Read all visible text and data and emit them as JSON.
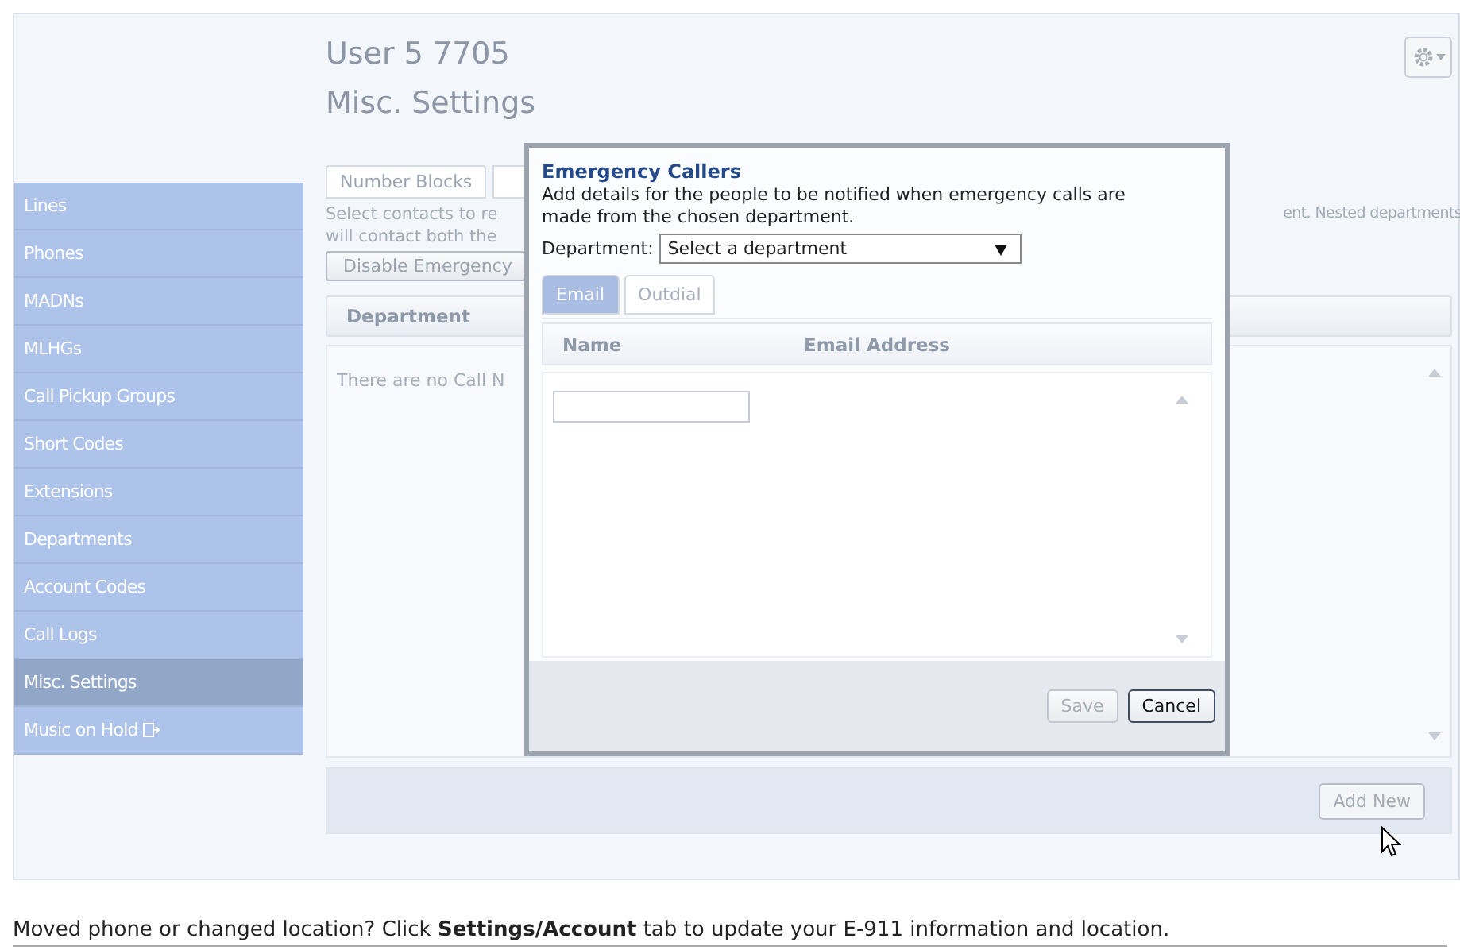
{
  "header": {
    "title": "User 5 7705",
    "subtitle": "Misc. Settings"
  },
  "sidebar": {
    "items": [
      {
        "label": "Lines",
        "selected": false,
        "kind": "plain"
      },
      {
        "label": "Phones",
        "selected": false,
        "kind": "plain"
      },
      {
        "label": "MADNs",
        "selected": false,
        "kind": "plain"
      },
      {
        "label": "MLHGs",
        "selected": false,
        "kind": "plain"
      },
      {
        "label": "Call Pickup Groups",
        "selected": false,
        "kind": "plain"
      },
      {
        "label": "Short Codes",
        "selected": false,
        "kind": "plain"
      },
      {
        "label": "Extensions",
        "selected": false,
        "kind": "plain"
      },
      {
        "label": "Departments",
        "selected": false,
        "kind": "plain"
      },
      {
        "label": "Account Codes",
        "selected": false,
        "kind": "plain"
      },
      {
        "label": "Call Logs",
        "selected": false,
        "kind": "plain"
      },
      {
        "label": "Misc. Settings",
        "selected": true,
        "kind": "plain"
      },
      {
        "label": "Music on Hold",
        "selected": false,
        "kind": "external"
      }
    ]
  },
  "tabs": [
    {
      "label": "Number Blocks",
      "selected": false
    }
  ],
  "description": {
    "line_1": "Select contacts to re",
    "line_2": "will contact both the",
    "right_part": "ent. Nested departments"
  },
  "disable_button": "Disable Emergency",
  "table": {
    "columns": [
      "Department"
    ],
    "empty_message": "There are no Call N"
  },
  "add_button": "Add New",
  "dialog": {
    "title": "Emergency Callers",
    "description": "Add details for the people to be notified when emergency calls are made from the chosen department.",
    "department_label": "Department:",
    "department_select": "Select a department",
    "tabs": [
      {
        "label": "Email",
        "selected": true
      },
      {
        "label": "Outdial",
        "selected": false
      }
    ],
    "columns": [
      "Name",
      "Email Address"
    ],
    "buttons": [
      {
        "label": "Save",
        "disabled": true
      },
      {
        "label": "Cancel",
        "disabled": false
      }
    ]
  },
  "footer": {
    "text": "Moved phone or changed location? Click **Settings/Account** tab to update your E-911 information and location."
  }
}
